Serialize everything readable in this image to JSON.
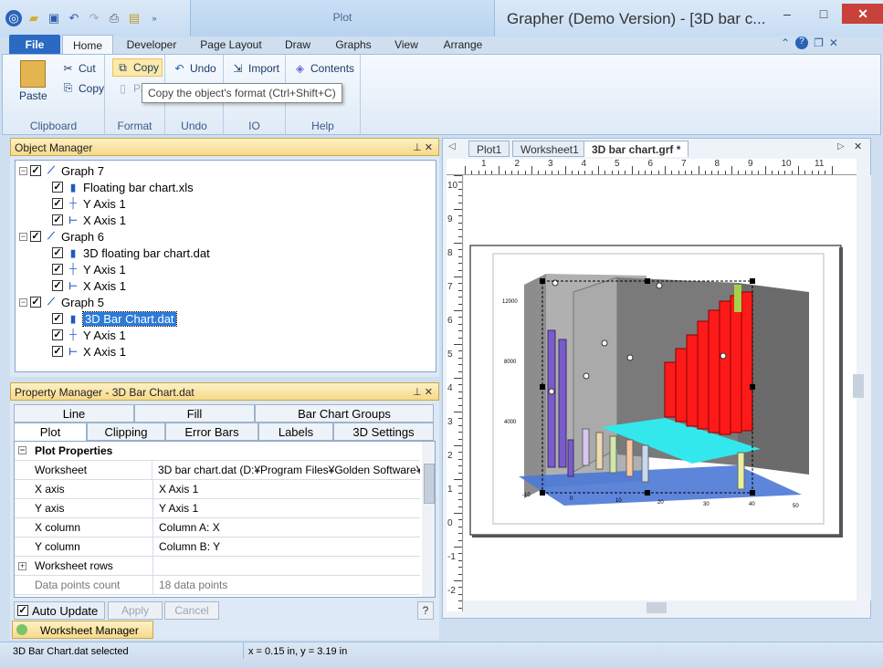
{
  "titlebar": {
    "context_tab": "Plot",
    "app_title": "Grapher (Demo Version) - [3D bar c...",
    "window_controls": {
      "minimize": "–",
      "maximize": "□",
      "close": "✕"
    }
  },
  "ribbon_tabs": [
    "File",
    "Home",
    "Developer",
    "Page Layout",
    "Draw",
    "Graphs",
    "View",
    "Arrange"
  ],
  "ribbon": {
    "clipboard": {
      "paste": "Paste",
      "cut": "Cut",
      "copy": "Copy",
      "label": "Clipboard"
    },
    "format": {
      "copy": "Copy",
      "paste": "Pa",
      "label": "Format"
    },
    "undo": {
      "undo": "Undo",
      "label": "Undo"
    },
    "io": {
      "import": "Import",
      "label": "IO"
    },
    "help": {
      "contents": "Contents",
      "label": "Help"
    },
    "tooltip": "Copy the object's format (Ctrl+Shift+C)"
  },
  "object_manager": {
    "title": "Object Manager",
    "items": [
      {
        "label": "Graph 7",
        "level": 0,
        "icon": "graph-icon"
      },
      {
        "label": "Floating bar chart.xls",
        "level": 1,
        "icon": "bar-chart-icon"
      },
      {
        "label": "Y Axis 1",
        "level": 1,
        "icon": "y-axis-icon"
      },
      {
        "label": "X Axis 1",
        "level": 1,
        "icon": "x-axis-icon"
      },
      {
        "label": "Graph 6",
        "level": 0,
        "icon": "graph-icon"
      },
      {
        "label": "3D floating bar chart.dat",
        "level": 1,
        "icon": "bar-chart-icon"
      },
      {
        "label": "Y Axis 1",
        "level": 1,
        "icon": "y-axis-icon"
      },
      {
        "label": "X Axis 1",
        "level": 1,
        "icon": "x-axis-icon"
      },
      {
        "label": "Graph 5",
        "level": 0,
        "icon": "graph-icon"
      },
      {
        "label": "3D Bar Chart.dat",
        "level": 1,
        "icon": "bar-chart-icon",
        "selected": true
      },
      {
        "label": "Y Axis 1",
        "level": 1,
        "icon": "y-axis-icon"
      },
      {
        "label": "X Axis 1",
        "level": 1,
        "icon": "x-axis-icon"
      }
    ]
  },
  "property_manager": {
    "title": "Property Manager - 3D Bar Chart.dat",
    "tabs_row1": [
      "Line",
      "Fill",
      "Bar Chart Groups"
    ],
    "tabs_row2": [
      "Plot",
      "Clipping",
      "Error Bars",
      "Labels",
      "3D Settings"
    ],
    "section": "Plot Properties",
    "rows": [
      {
        "key": "Worksheet",
        "value": "3D bar chart.dat (D:¥Program Files¥Golden Software¥"
      },
      {
        "key": "X axis",
        "value": "X Axis 1"
      },
      {
        "key": "Y axis",
        "value": "Y Axis 1"
      },
      {
        "key": "X column",
        "value": "Column A: X"
      },
      {
        "key": "Y column",
        "value": "Column B: Y"
      },
      {
        "key": "Worksheet rows",
        "value": ""
      },
      {
        "key": "Data points count",
        "value": "18 data points"
      }
    ],
    "auto_update": "Auto Update",
    "apply": "Apply",
    "cancel": "Cancel",
    "help": "?"
  },
  "worksheet_manager": "Worksheet Manager",
  "doc_tabs": [
    "Plot1",
    "Worksheet1",
    "3D bar chart.grf *"
  ],
  "rulers": {
    "horizontal": [
      "1",
      "2",
      "3",
      "4",
      "5",
      "6",
      "7",
      "8",
      "9",
      "10",
      "11"
    ],
    "vertical": [
      "10",
      "9",
      "8",
      "7",
      "6",
      "5",
      "4",
      "3",
      "2",
      "1",
      "0",
      "-1",
      "-2"
    ]
  },
  "chart": {
    "y_ticks": [
      "12000",
      "8000",
      "4000"
    ],
    "x_ticks": [
      "-10",
      "0",
      "10",
      "20",
      "30",
      "40",
      "50"
    ]
  },
  "status": {
    "left": "3D Bar Chart.dat selected",
    "coords": "x = 0.15 in, y = 3.19 in"
  }
}
